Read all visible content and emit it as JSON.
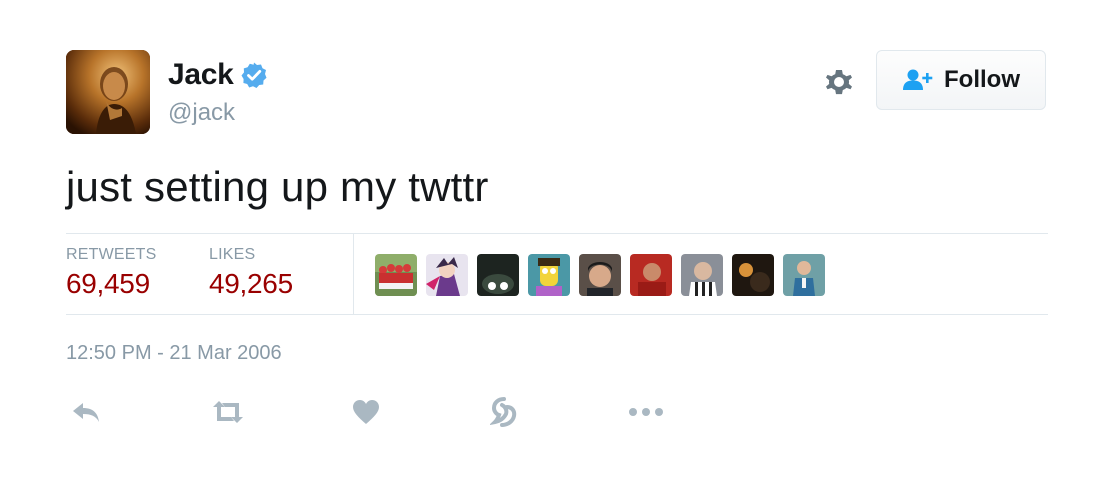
{
  "user": {
    "display_name": "Jack",
    "handle": "@jack",
    "verified": true,
    "avatar_icon": "user-avatar"
  },
  "header": {
    "settings_icon": "gear-icon",
    "follow_label": "Follow",
    "follow_icon": "follow-user-icon"
  },
  "tweet": {
    "text": "just setting up my twttr",
    "timestamp": "12:50 PM - 21 Mar 2006"
  },
  "stats": {
    "retweets_label": "RETWEETS",
    "retweets_value": "69,459",
    "likes_label": "LIKES",
    "likes_value": "49,265"
  },
  "likers": [
    {
      "icon": "liker-avatar-1"
    },
    {
      "icon": "liker-avatar-2"
    },
    {
      "icon": "liker-avatar-3"
    },
    {
      "icon": "liker-avatar-4"
    },
    {
      "icon": "liker-avatar-5"
    },
    {
      "icon": "liker-avatar-6"
    },
    {
      "icon": "liker-avatar-7"
    },
    {
      "icon": "liker-avatar-8"
    },
    {
      "icon": "liker-avatar-9"
    }
  ],
  "actions": [
    "reply-icon",
    "retweet-icon",
    "like-icon",
    "moments-icon",
    "more-icon"
  ],
  "colors": {
    "text_primary": "#14171a",
    "text_secondary": "#8899a6",
    "stat_value": "#990000",
    "verified_blue": "#55acee",
    "border": "#e1e8ed",
    "icon_gray": "#aab8c2"
  }
}
